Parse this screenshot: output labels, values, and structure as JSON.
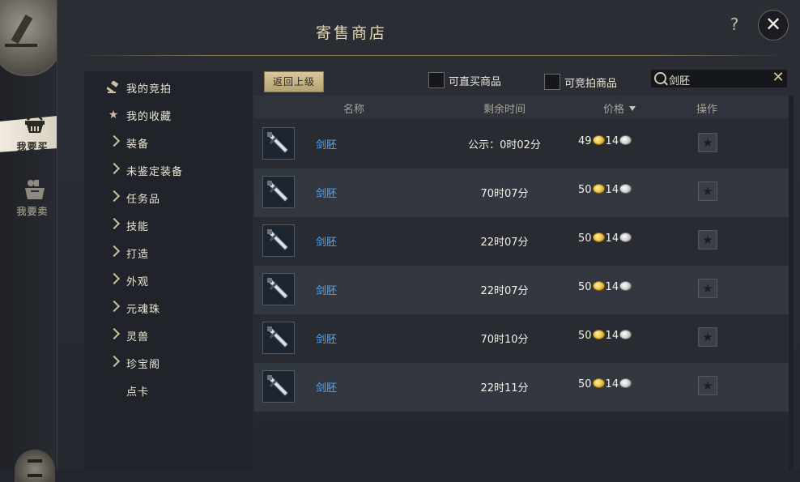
{
  "window": {
    "title": "寄售商店",
    "help_label": "?",
    "close_label": "✕"
  },
  "nav": {
    "tabs": [
      {
        "label": "我要买",
        "icon": "basket-icon",
        "active": true
      },
      {
        "label": "我要卖",
        "icon": "goods-bag-icon",
        "active": false
      }
    ]
  },
  "categories": [
    {
      "label": "我的竞拍",
      "icon": "gavel-icon"
    },
    {
      "label": "我的收藏",
      "icon": "star-icon"
    },
    {
      "label": "装备",
      "icon": "chevron-right-icon"
    },
    {
      "label": "未鉴定装备",
      "icon": "chevron-right-icon"
    },
    {
      "label": "任务品",
      "icon": "chevron-right-icon"
    },
    {
      "label": "技能",
      "icon": "chevron-right-icon"
    },
    {
      "label": "打造",
      "icon": "chevron-right-icon"
    },
    {
      "label": "外观",
      "icon": "chevron-right-icon"
    },
    {
      "label": "元魂珠",
      "icon": "chevron-right-icon"
    },
    {
      "label": "灵兽",
      "icon": "chevron-right-icon"
    },
    {
      "label": "珍宝阁",
      "icon": "chevron-right-icon"
    },
    {
      "label": "点卡",
      "icon": ""
    }
  ],
  "toolbar": {
    "back_label": "返回上级",
    "filter_buyable_label": "可直买商品",
    "filter_buyable_checked": false,
    "filter_auction_label": "可竞拍商品",
    "filter_auction_checked": false,
    "search_value": "剑胚",
    "search_clear_label": "✕"
  },
  "table": {
    "headers": {
      "name": "名称",
      "time": "剩余时间",
      "price": "价格",
      "action": "操作"
    },
    "rows": [
      {
        "name": "剑胚",
        "time": "公示：0时02分",
        "gold": "49",
        "silver": "14"
      },
      {
        "name": "剑胚",
        "time": "70时07分",
        "gold": "50",
        "silver": "14"
      },
      {
        "name": "剑胚",
        "time": "22时07分",
        "gold": "50",
        "silver": "14"
      },
      {
        "name": "剑胚",
        "time": "22时07分",
        "gold": "50",
        "silver": "14"
      },
      {
        "name": "剑胚",
        "time": "70时10分",
        "gold": "50",
        "silver": "14"
      },
      {
        "name": "剑胚",
        "time": "22时11分",
        "gold": "50",
        "silver": "14"
      }
    ]
  },
  "colors": {
    "item_name": "#5aa8f0",
    "accent_gold": "#d7c79a",
    "title_text": "#e4d6b2"
  }
}
